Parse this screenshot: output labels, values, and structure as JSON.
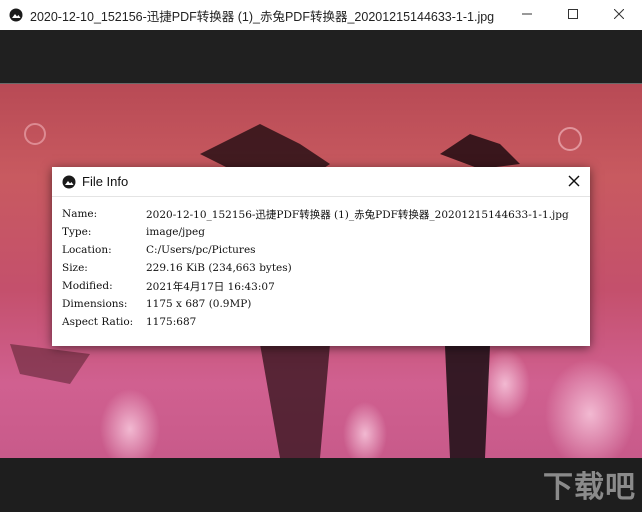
{
  "window": {
    "title": "2020-12-10_152156-迅捷PDF转换器 (1)_赤兔PDF转换器_20201215144633-1-1.jpg"
  },
  "dialog": {
    "title": "File Info",
    "rows": [
      {
        "label": "Name:",
        "value": "2020-12-10_152156-迅捷PDF转换器 (1)_赤兔PDF转换器_20201215144633-1-1.jpg"
      },
      {
        "label": "Type:",
        "value": "image/jpeg"
      },
      {
        "label": "Location:",
        "value": "C:/Users/pc/Pictures"
      },
      {
        "label": "Size:",
        "value": "229.16 KiB (234,663 bytes)"
      },
      {
        "label": "Modified:",
        "value": "2021年4月17日 16:43:07"
      },
      {
        "label": "Dimensions:",
        "value": "1175 x 687 (0.9MP)"
      },
      {
        "label": "Aspect Ratio:",
        "value": "1175:687"
      }
    ]
  },
  "watermark": "下载吧",
  "icons": {
    "app": "app-logo-icon",
    "minimize": "minimize-icon",
    "maximize": "maximize-icon",
    "close": "close-icon"
  }
}
